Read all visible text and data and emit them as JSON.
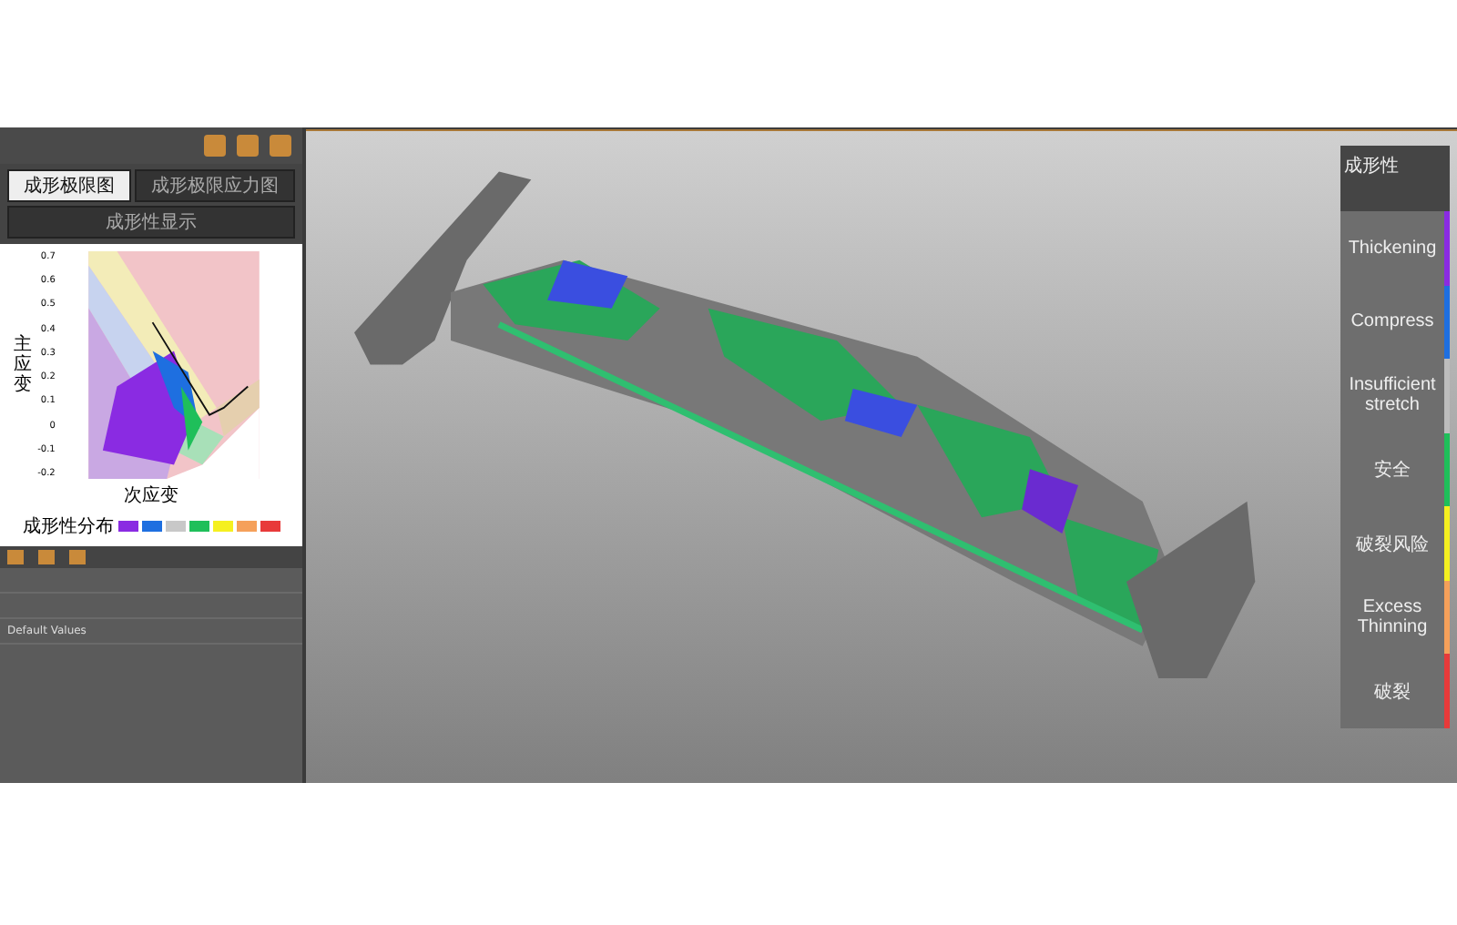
{
  "panel_tabs": [
    {
      "label": "成形极限图",
      "selected": true
    },
    {
      "label": "成形极限应力图",
      "selected": false
    },
    {
      "label": "成形性显示",
      "selected": false
    }
  ],
  "chart": {
    "y_axis_label": "主应变",
    "x_axis_label": "次应变",
    "yticks": [
      "0.7",
      "0.6",
      "0.5",
      "0.4",
      "0.3",
      "0.2",
      "0.1",
      "0",
      "-0.1",
      "-0.2"
    ]
  },
  "fld_legend": {
    "label": "成形性分布",
    "swatches": [
      {
        "color": "#8a2be2"
      },
      {
        "color": "#1e6fe0"
      },
      {
        "color": "#c8c8c8"
      },
      {
        "color": "#1fbf5a"
      },
      {
        "color": "#f5f020"
      },
      {
        "color": "#f5a05a"
      },
      {
        "color": "#e83a3a"
      }
    ]
  },
  "settings_row": {
    "value": "Default Values"
  },
  "legend": {
    "title": "成形性",
    "items": [
      {
        "label": "Thickening",
        "color": "#8a2be2"
      },
      {
        "label": "Compress",
        "color": "#1e6fe0"
      },
      {
        "label": "Insufficient stretch",
        "color": "#bdbdbd"
      },
      {
        "label": "安全",
        "color": "#1fbf5a"
      },
      {
        "label": "破裂风险",
        "color": "#f5f020"
      },
      {
        "label": "Excess Thinning",
        "color": "#f5a05a"
      },
      {
        "label": "破裂",
        "color": "#e83a3a"
      }
    ]
  }
}
